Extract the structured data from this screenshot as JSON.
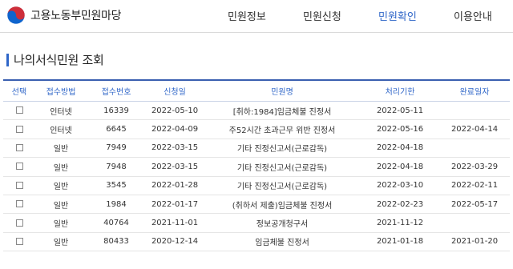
{
  "app": {
    "logo_text": "고용노동부민원마당"
  },
  "nav": {
    "items": [
      {
        "label": "민원정보",
        "active": false
      },
      {
        "label": "민원신청",
        "active": false
      },
      {
        "label": "민원확인",
        "active": true
      },
      {
        "label": "이용안내",
        "active": false
      }
    ]
  },
  "page": {
    "title": "나의서식민원 조회"
  },
  "table": {
    "headers": [
      "선택",
      "접수방법",
      "접수번호",
      "신청일",
      "민원명",
      "처리기한",
      "완료일자"
    ],
    "rows": [
      {
        "method": "인터넷",
        "number": "16339",
        "date": "2022-05-10",
        "name": "[취하:1984]임금체불 진정서",
        "deadline": "2022-05-11",
        "completed": ""
      },
      {
        "method": "인터넷",
        "number": "6645",
        "date": "2022-04-09",
        "name": "주52시간 초과근무 위반 진정서",
        "deadline": "2022-05-16",
        "completed": "2022-04-14"
      },
      {
        "method": "일반",
        "number": "7949",
        "date": "2022-03-15",
        "name": "기타 진정신고서(근로감독)",
        "deadline": "2022-04-18",
        "completed": ""
      },
      {
        "method": "일반",
        "number": "7948",
        "date": "2022-03-15",
        "name": "기타 진정신고서(근로감독)",
        "deadline": "2022-04-18",
        "completed": "2022-03-29"
      },
      {
        "method": "일반",
        "number": "3545",
        "date": "2022-01-28",
        "name": "기타 진정신고서(근로감독)",
        "deadline": "2022-03-10",
        "completed": "2022-02-11"
      },
      {
        "method": "일반",
        "number": "1984",
        "date": "2022-01-17",
        "name": "(취하서 제출)임금체불 진정서",
        "deadline": "2022-02-23",
        "completed": "2022-05-17"
      },
      {
        "method": "일반",
        "number": "40764",
        "date": "2021-11-01",
        "name": "정보공개청구서",
        "deadline": "2021-11-12",
        "completed": ""
      },
      {
        "method": "일반",
        "number": "80433",
        "date": "2020-12-14",
        "name": "임금체불 진정서",
        "deadline": "2021-01-18",
        "completed": "2021-01-20"
      }
    ]
  },
  "colors": {
    "accent": "#2f66c8",
    "border": "#3a5fb0",
    "emblem_red": "#cd2e3a",
    "emblem_blue": "#0f64cd"
  },
  "icons": {
    "logo": "government-emblem-icon",
    "checkbox": "checkbox-icon"
  }
}
